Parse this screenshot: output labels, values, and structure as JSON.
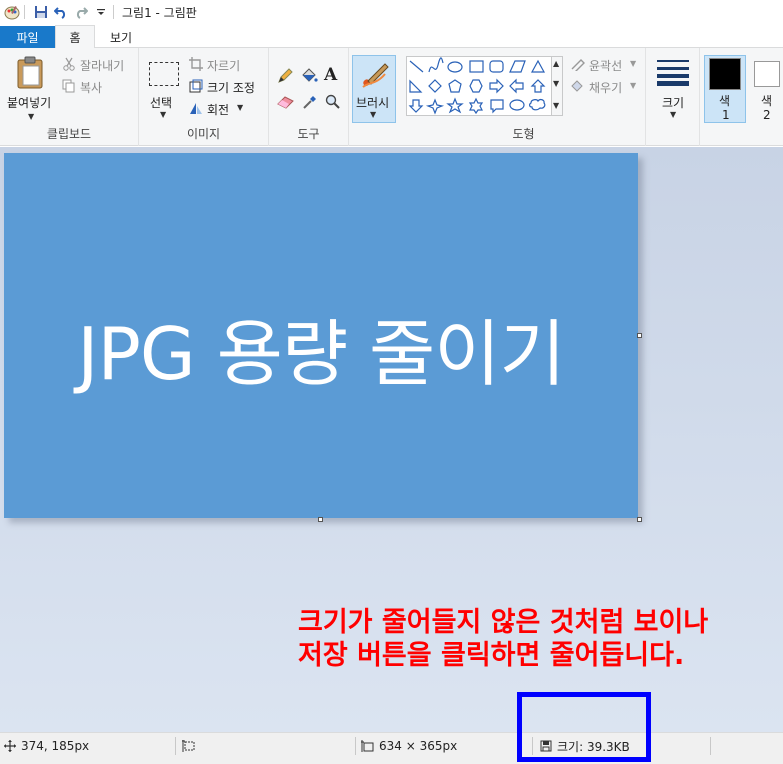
{
  "window": {
    "title": "그림1 - 그림판"
  },
  "tabs": {
    "file": "파일",
    "home": "홈",
    "view": "보기"
  },
  "clipboard": {
    "paste": "붙여넣기",
    "cut": "잘라내기",
    "copy": "복사",
    "group": "클립보드"
  },
  "image": {
    "select": "선택",
    "crop": "자르기",
    "resize": "크기 조정",
    "rotate": "회전",
    "group": "이미지"
  },
  "tools": {
    "group": "도구"
  },
  "brush": {
    "label": "브러시"
  },
  "shapes": {
    "outline": "윤곽선",
    "fill": "채우기",
    "group": "도형"
  },
  "size": {
    "label": "크기"
  },
  "colors": {
    "color1_a": "색",
    "color1_b": "1",
    "color2_a": "색",
    "color2_b": "2",
    "color1_value": "#000000",
    "color2_value": "#ffffff"
  },
  "canvas": {
    "text": "JPG 용량 줄이기",
    "background": "#5b9bd5"
  },
  "annotation": {
    "line1": "크기가 줄어들지 않은 것처럼 보이나",
    "line2": "저장 버튼을 클릭하면 줄어듭니다.",
    "color": "#ff0000",
    "box_color": "#0000ff"
  },
  "status": {
    "cursor_pos": "374, 185px",
    "image_size": "634 × 365px",
    "file_size": "크기: 39.3KB"
  }
}
